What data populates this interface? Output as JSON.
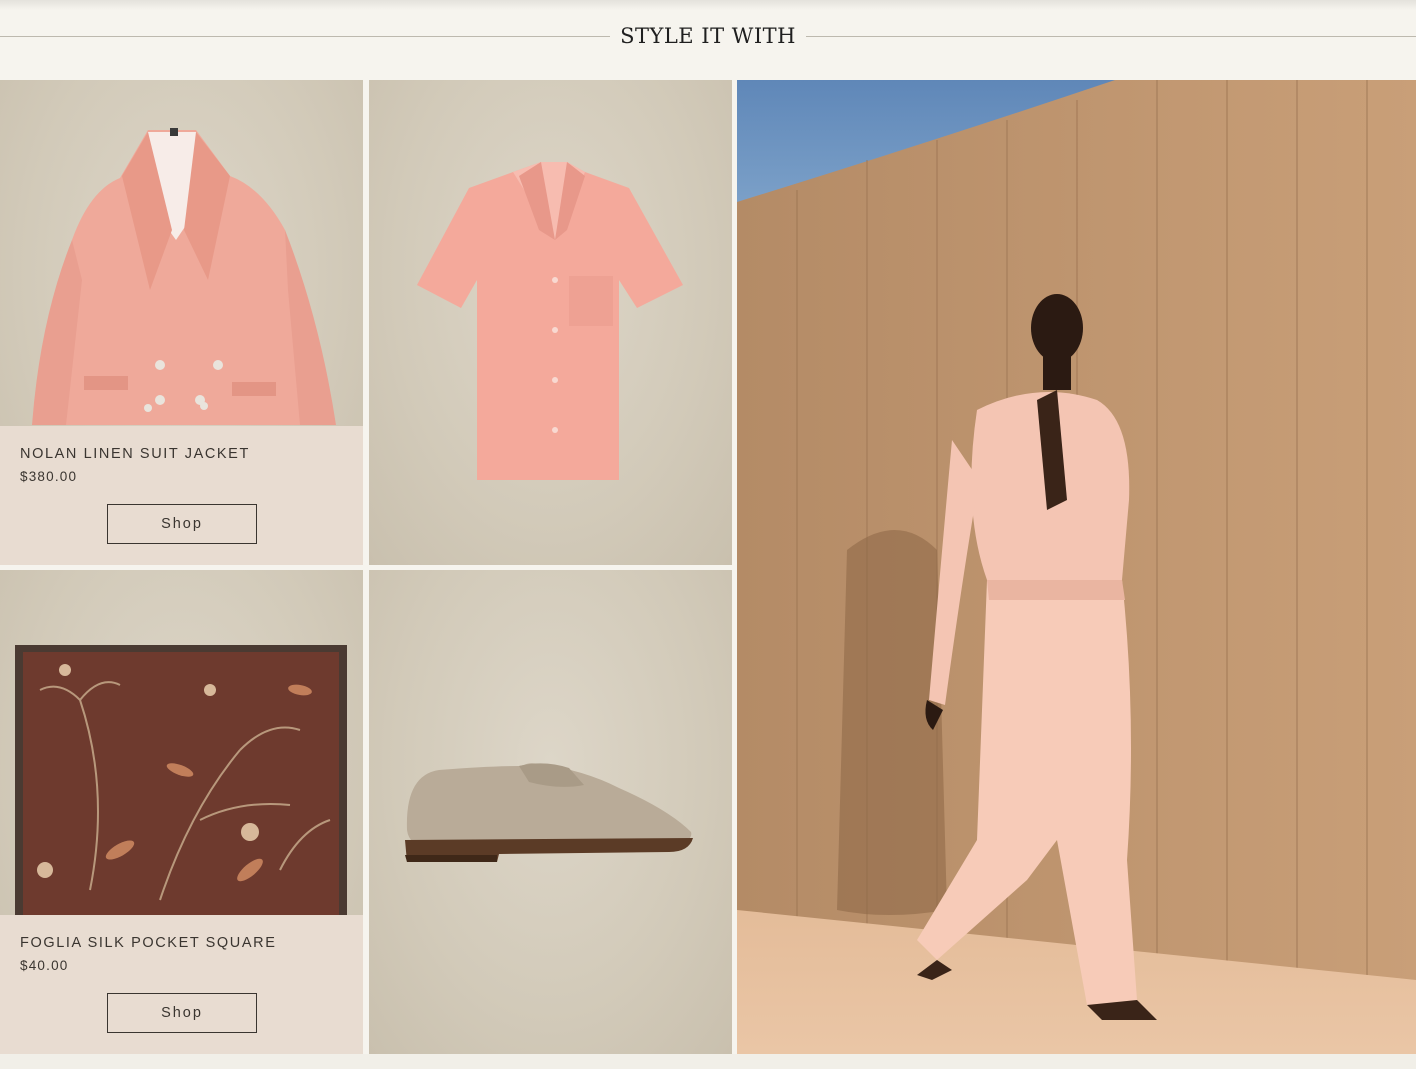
{
  "section": {
    "title": "STYLE IT WITH"
  },
  "products": [
    {
      "name": "NOLAN LINEN SUIT JACKET",
      "price": "$380.00",
      "cta": "Shop",
      "image": "pink-linen-double-breasted-jacket"
    },
    {
      "image": "pink-camp-collar-shirt"
    },
    {
      "name": "FOGLIA SILK POCKET SQUARE",
      "price": "$40.00",
      "cta": "Shop",
      "image": "brown-floral-silk-pocket-square"
    },
    {
      "image": "taupe-suede-penny-loafer"
    }
  ],
  "hero": {
    "image": "model-walking-in-pink-linen-by-concrete-wall"
  },
  "colors": {
    "background": "#f6f4ee",
    "tile": "#d2cab9",
    "info_panel": "#e8dcd1",
    "text": "#3a3530",
    "linen_pink": "#f1a89a"
  }
}
